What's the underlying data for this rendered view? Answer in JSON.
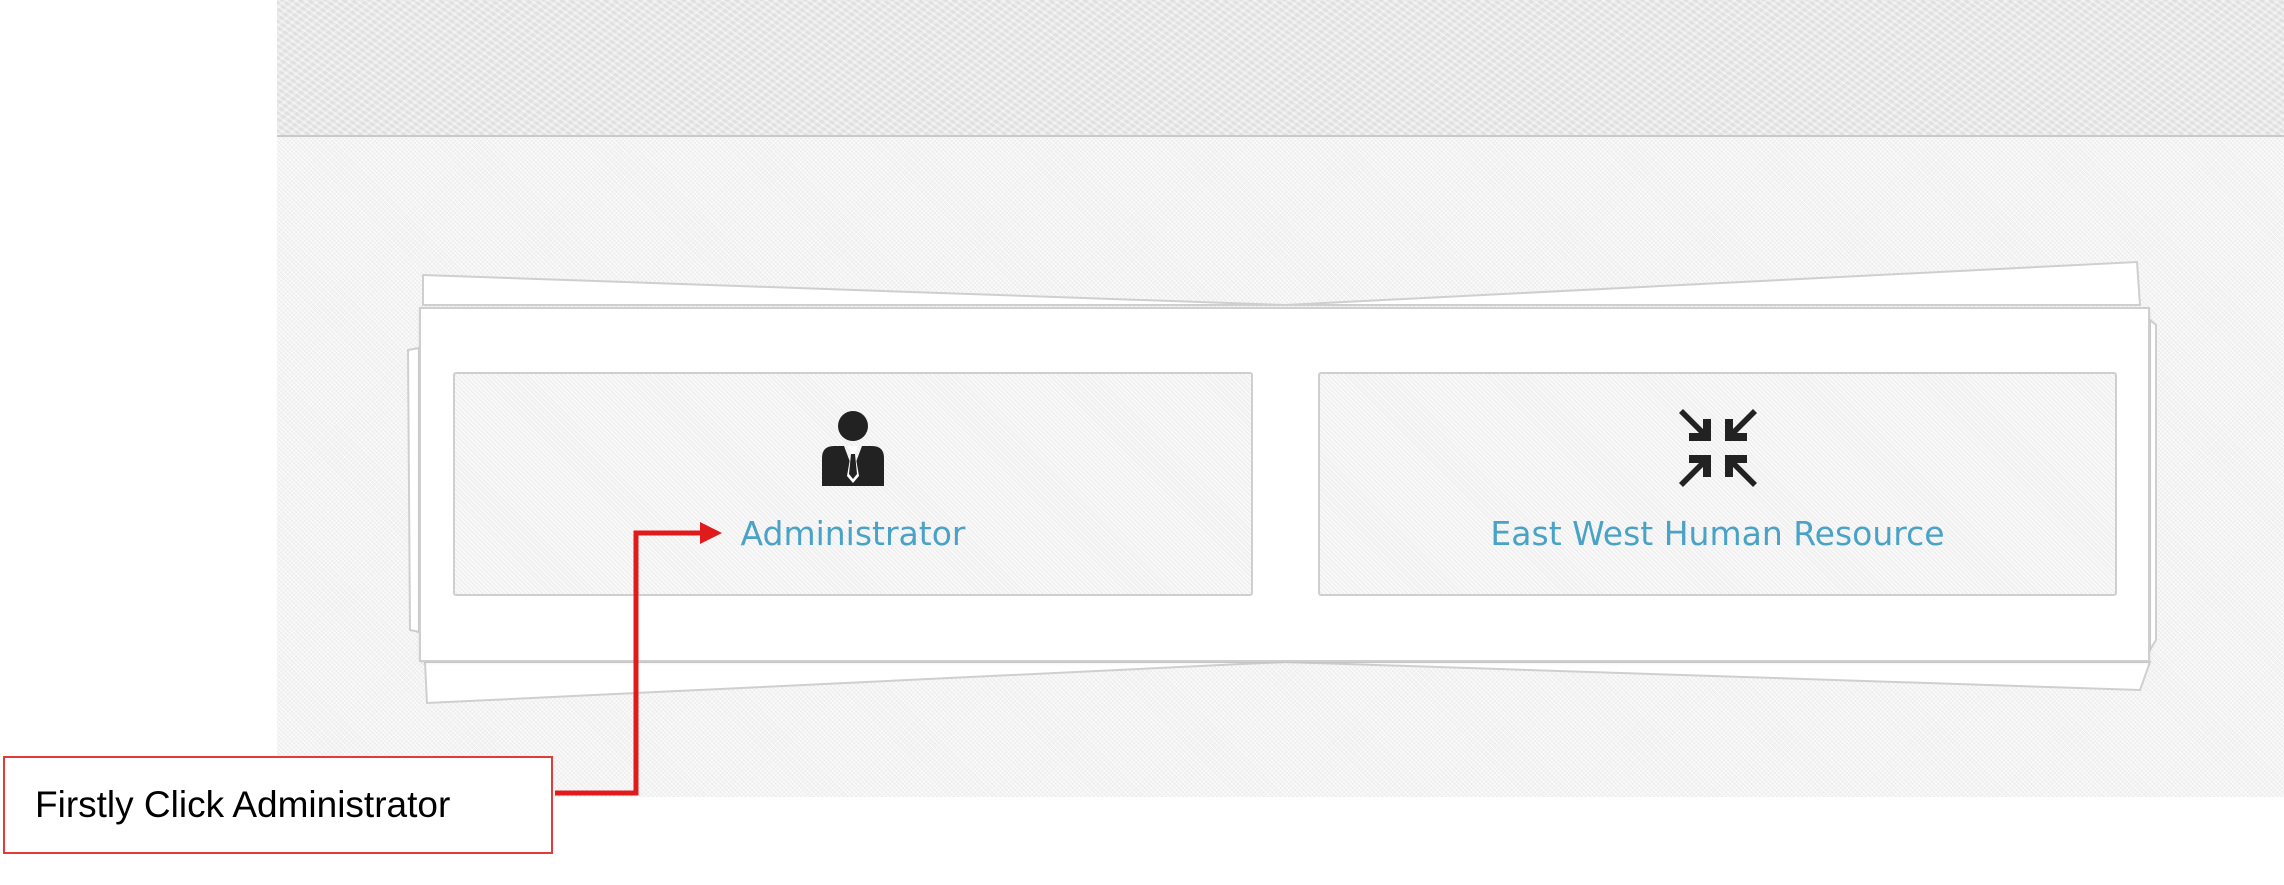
{
  "tiles": [
    {
      "label": "Administrator",
      "icon": "user-tie-icon"
    },
    {
      "label": "East West Human Resource",
      "icon": "compress-arrows-icon"
    }
  ],
  "annotation": {
    "text": "Firstly Click Administrator",
    "color": "#e01b1b"
  },
  "colors": {
    "link": "#4aa3c6",
    "icon": "#222222"
  }
}
